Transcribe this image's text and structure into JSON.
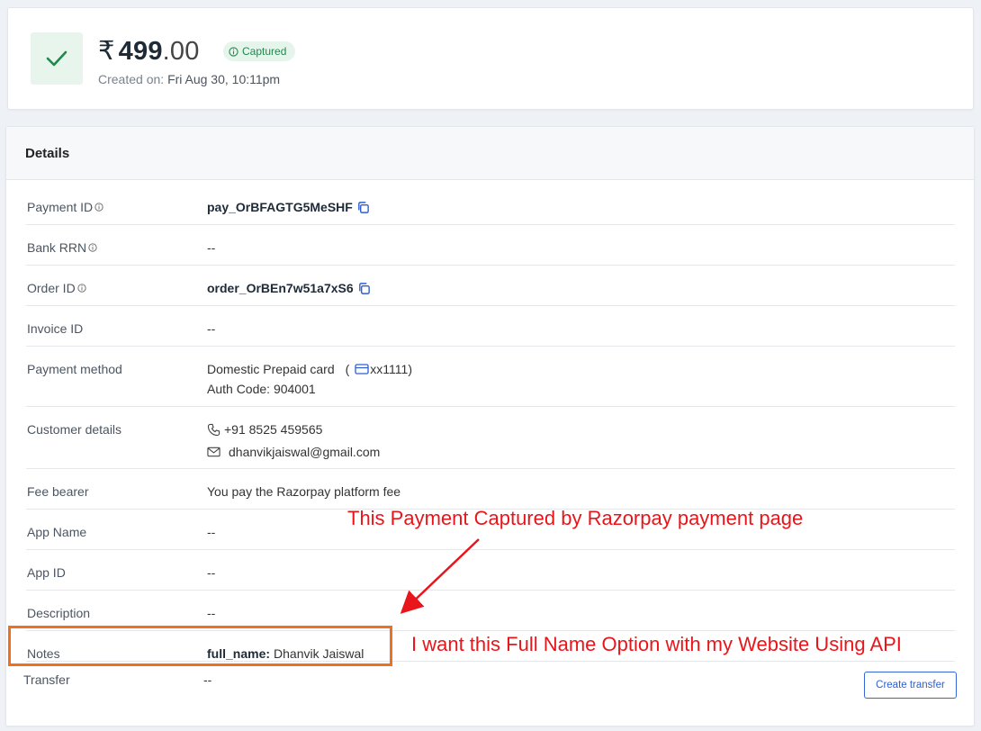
{
  "summary": {
    "currency_symbol": "₹",
    "amount_whole": "499",
    "amount_decimal": ".00",
    "status_badge": "Captured",
    "created_label": "Created on:",
    "created_value": "Fri Aug 30, 10:11pm"
  },
  "details": {
    "title": "Details",
    "rows": {
      "payment_id": {
        "label": "Payment ID",
        "value": "pay_OrBFAGTG5MeSHF"
      },
      "bank_rrn": {
        "label": "Bank RRN",
        "value": "--"
      },
      "order_id": {
        "label": "Order ID",
        "value": "order_OrBEn7w51a7xS6"
      },
      "invoice_id": {
        "label": "Invoice ID",
        "value": "--"
      },
      "payment_method": {
        "label": "Payment method",
        "value": "Domestic Prepaid card",
        "card_open": "(",
        "card_suffix": "xx1111)",
        "auth_code": "Auth Code: 904001"
      },
      "customer_details": {
        "label": "Customer details",
        "phone": "+91 8525 459565",
        "email": "dhanvikjaiswal@gmail.com"
      },
      "fee_bearer": {
        "label": "Fee bearer",
        "value": "You pay the Razorpay platform fee"
      },
      "app_name": {
        "label": "App Name",
        "value": "--"
      },
      "app_id": {
        "label": "App ID",
        "value": "--"
      },
      "description": {
        "label": "Description",
        "value": "--"
      },
      "notes": {
        "label": "Notes",
        "key": "full_name:",
        "value": "Dhanvik Jaiswal"
      },
      "transfer": {
        "label": "Transfer",
        "value": "--"
      }
    },
    "create_transfer_button": "Create transfer"
  },
  "annotations": {
    "top_text": "This Payment Captured by Razorpay payment page",
    "right_text": "I want this Full Name Option with my Website Using API",
    "color": "#e8161b",
    "box_color": "#f07021"
  },
  "colors": {
    "success": "#1c8a4b",
    "accent_blue": "#2f5fd0"
  },
  "icons": [
    "check-icon",
    "info-icon",
    "copy-icon",
    "card-icon",
    "phone-icon",
    "mail-icon",
    "arrow-icon"
  ]
}
